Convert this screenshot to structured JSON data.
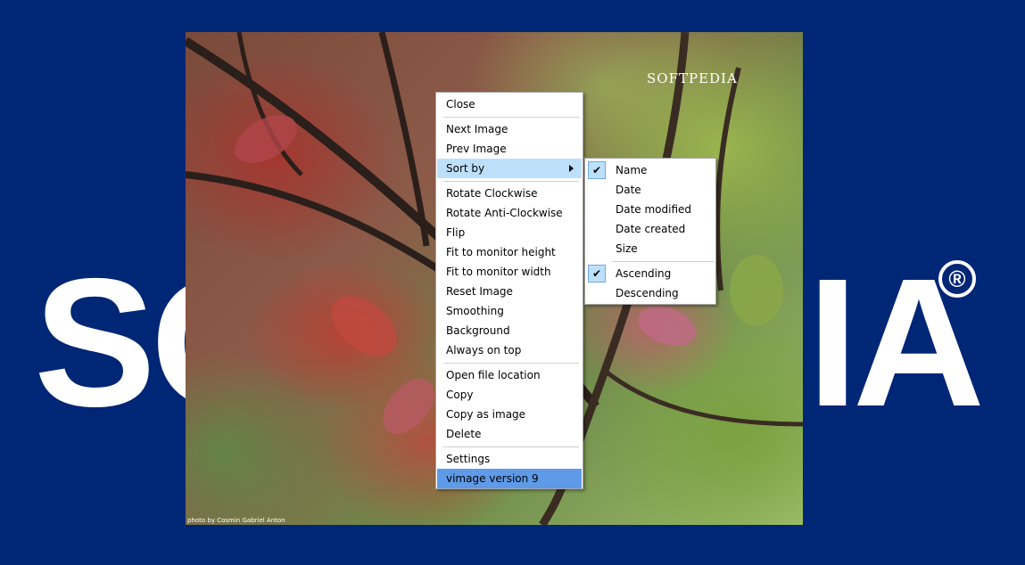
{
  "background": {
    "logo_left": "SO",
    "logo_right": "IA",
    "registered_mark": "®",
    "color": "#002676"
  },
  "photo": {
    "watermark": "SOFTPEDIA",
    "credit": "photo by Cosmin Gabriel Anton"
  },
  "context_menu": {
    "items": [
      {
        "label": "Close"
      },
      {
        "label": "Next Image"
      },
      {
        "label": "Prev Image"
      },
      {
        "label": "Sort by",
        "submenu": true,
        "highlighted": true
      },
      {
        "label": "Rotate Clockwise"
      },
      {
        "label": "Rotate Anti-Clockwise"
      },
      {
        "label": "Flip"
      },
      {
        "label": "Fit to monitor height"
      },
      {
        "label": "Fit to monitor width"
      },
      {
        "label": "Reset Image"
      },
      {
        "label": "Smoothing"
      },
      {
        "label": "Background"
      },
      {
        "label": "Always on top"
      },
      {
        "label": "Open file location"
      },
      {
        "label": "Copy"
      },
      {
        "label": "Copy as image"
      },
      {
        "label": "Delete"
      },
      {
        "label": "Settings"
      },
      {
        "label": "vimage version 9",
        "selected": true
      }
    ]
  },
  "sort_submenu": {
    "items": [
      {
        "label": "Name",
        "checked": true
      },
      {
        "label": "Date",
        "checked": false
      },
      {
        "label": "Date modified",
        "checked": false
      },
      {
        "label": "Date created",
        "checked": false
      },
      {
        "label": "Size",
        "checked": false
      },
      {
        "label": "Ascending",
        "checked": true
      },
      {
        "label": "Descending",
        "checked": false
      }
    ],
    "check_glyph": "✔"
  },
  "colors": {
    "menu_highlight": "#bde0fa",
    "menu_selected": "#5e9ae7"
  }
}
